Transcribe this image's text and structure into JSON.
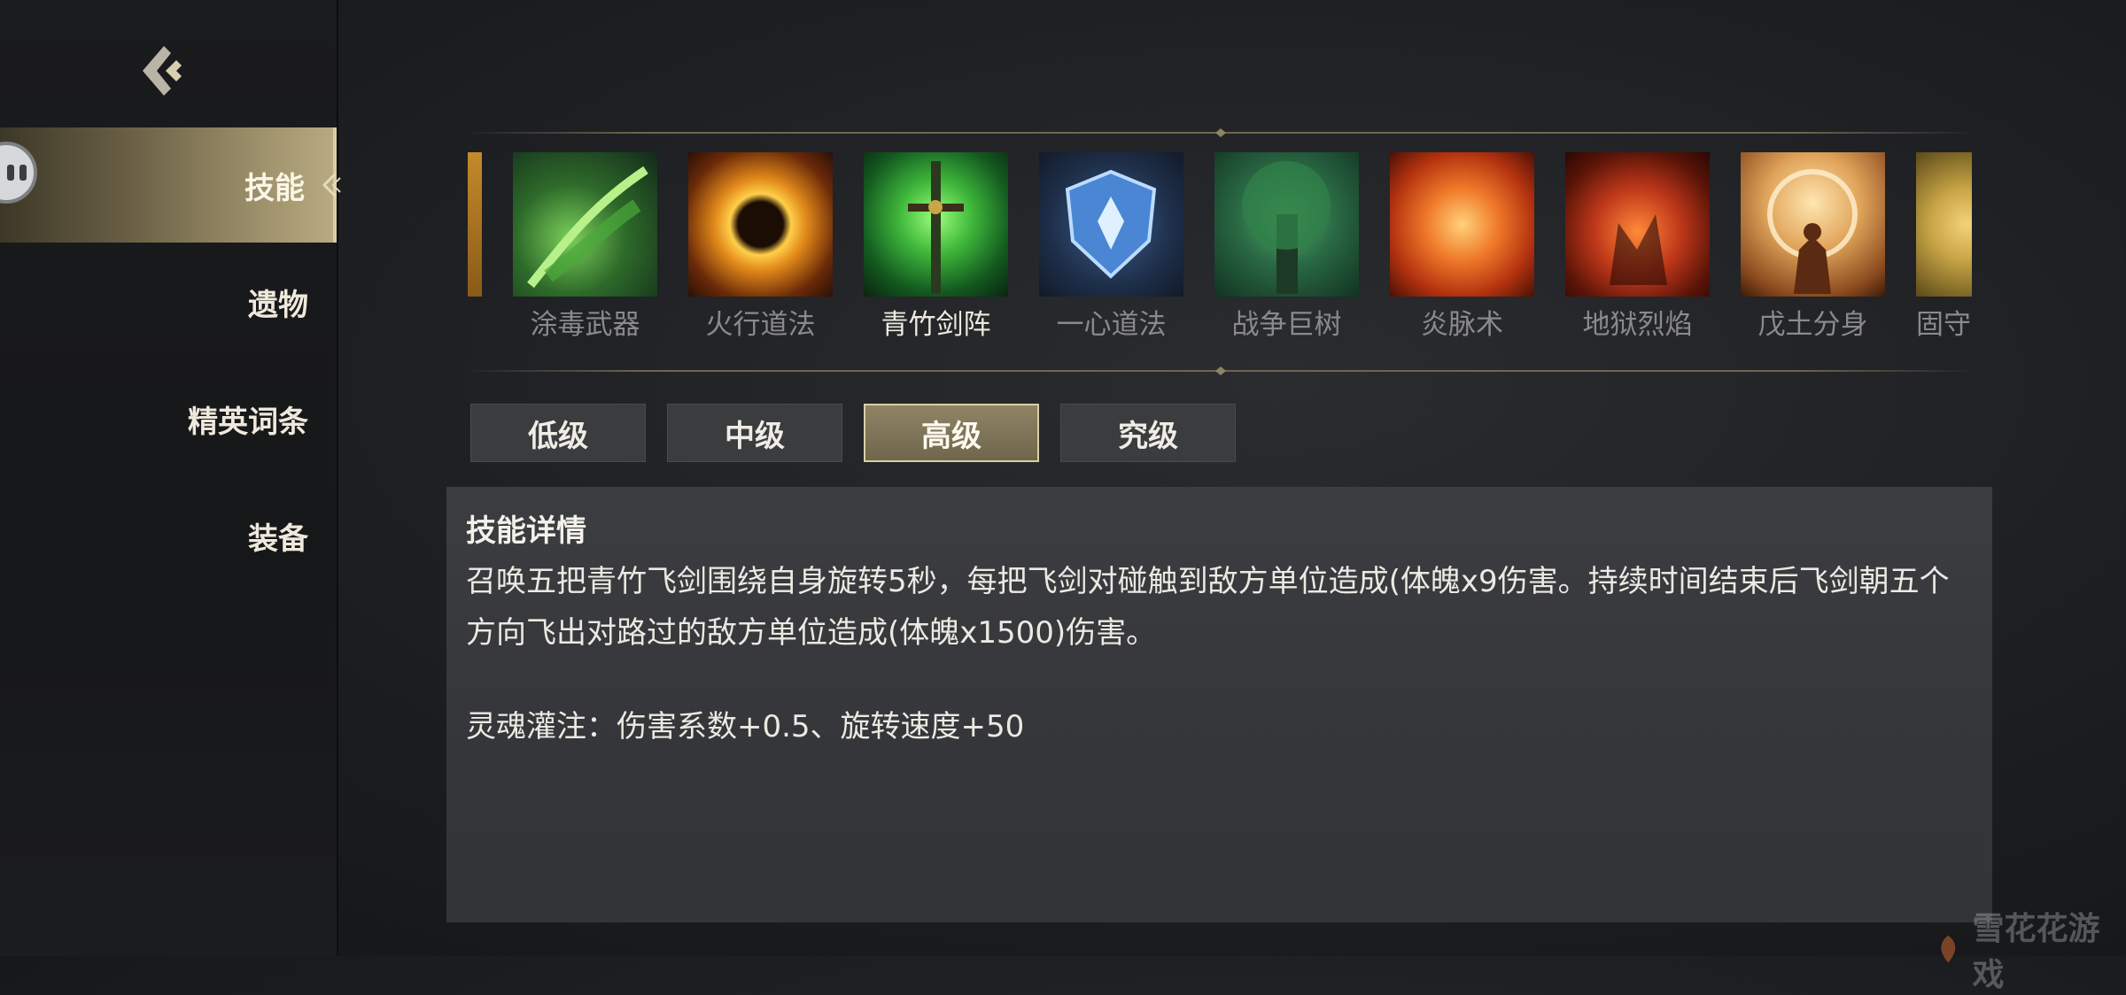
{
  "nav": {
    "items": [
      {
        "label": "技能",
        "active": true
      },
      {
        "label": "遗物",
        "active": false
      },
      {
        "label": "精英词条",
        "active": false
      },
      {
        "label": "装备",
        "active": false
      }
    ]
  },
  "skills": [
    {
      "label": "涂毒武器",
      "icon": "poison-weapon-icon",
      "color": "#4e9a3a"
    },
    {
      "label": "火行道法",
      "icon": "fire-ring-icon",
      "color": "#e49a22"
    },
    {
      "label": "青竹剑阵",
      "icon": "bamboo-sword-icon",
      "color": "#3fbf45",
      "selected": true
    },
    {
      "label": "一心道法",
      "icon": "blue-shield-icon",
      "color": "#3f78c0"
    },
    {
      "label": "战争巨树",
      "icon": "war-tree-icon",
      "color": "#2f7f55"
    },
    {
      "label": "炎脉术",
      "icon": "flame-vein-icon",
      "color": "#e0572a"
    },
    {
      "label": "地狱烈焰",
      "icon": "hellfire-icon",
      "color": "#c23a1d"
    },
    {
      "label": "戊土分身",
      "icon": "earth-clone-icon",
      "color": "#e0a45a"
    },
    {
      "label": "固守",
      "icon": "partial-skill-icon",
      "color": "#c9a646"
    }
  ],
  "levels": [
    {
      "label": "低级",
      "active": false
    },
    {
      "label": "中级",
      "active": false
    },
    {
      "label": "高级",
      "active": true
    },
    {
      "label": "究级",
      "active": false
    }
  ],
  "detail": {
    "title": "技能详情",
    "body": "召唤五把青竹飞剑围绕自身旋转5秒，每把飞剑对碰触到敌方单位造成(体魄x9伤害。持续时间结束后飞剑朝五个方向飞出对路过的敌方单位造成(体魄x1500)伤害。",
    "extra": "灵魂灌注：伤害系数+0.5、旋转速度+50"
  },
  "watermark": "雪花花游戏",
  "colors": {
    "accent_gold": "#b7aa83",
    "tab_bg": "#3b3c3e",
    "panel_bg": "#37393c"
  }
}
